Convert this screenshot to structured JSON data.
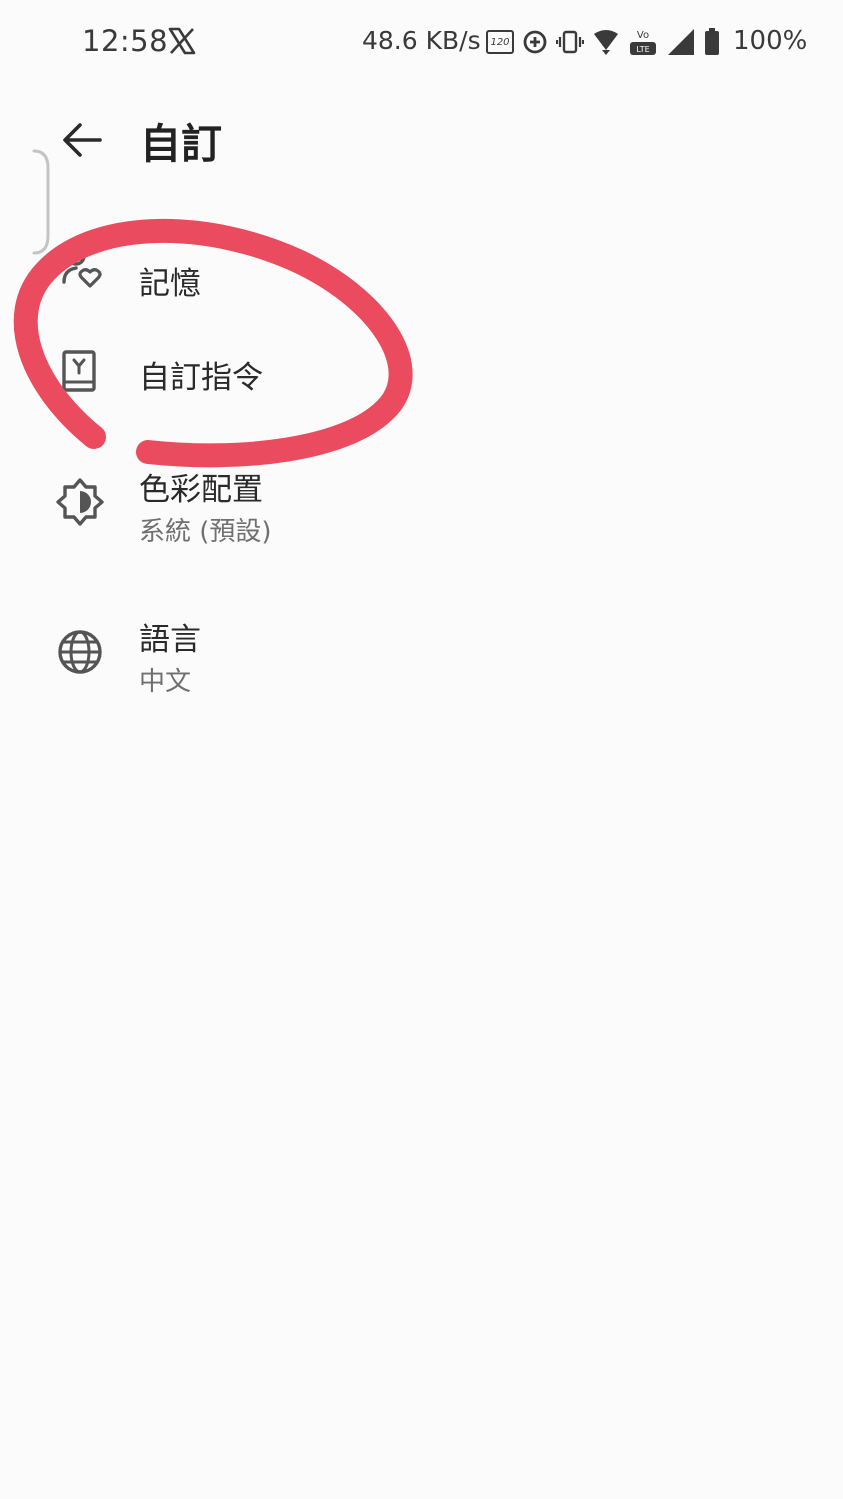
{
  "status_bar": {
    "time": "12:58",
    "network_speed": "48.6 KB/s",
    "refresh_rate_badge": "120",
    "volte_badge": "LTE",
    "battery_percent": "100%",
    "icons": [
      "x-logo-icon",
      "refresh-rate-icon",
      "data-saver-icon",
      "vibrate-icon",
      "wifi-icon",
      "volte-icon",
      "cell-signal-icon",
      "battery-icon"
    ]
  },
  "header": {
    "title": "自訂"
  },
  "settings": {
    "items": [
      {
        "label": "記憶",
        "sub": "",
        "icon": "memory-heart-icon"
      },
      {
        "label": "自訂指令",
        "sub": "",
        "icon": "custom-instructions-icon"
      },
      {
        "label": "色彩配置",
        "sub": "系統 (預設)",
        "icon": "brightness-icon"
      },
      {
        "label": "語言",
        "sub": "中文",
        "icon": "globe-icon"
      }
    ]
  },
  "colors": {
    "background": "#fbfbfb",
    "text_primary": "#2a2a2a",
    "text_secondary": "#707070",
    "annotation_stroke": "#ea4b5e"
  }
}
